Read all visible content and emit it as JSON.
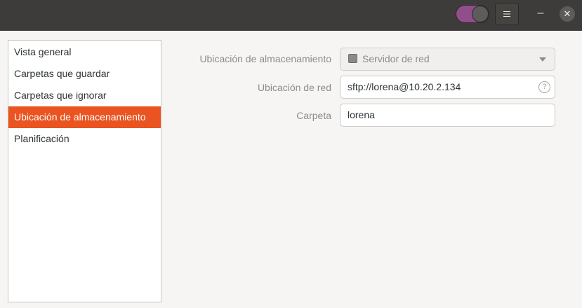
{
  "header": {
    "toggle_state": "on",
    "menu_icon": "hamburger-icon",
    "minimize_glyph": "–",
    "close_glyph": "✕"
  },
  "sidebar": {
    "items": [
      {
        "label": "Vista general",
        "active": false
      },
      {
        "label": "Carpetas que guardar",
        "active": false
      },
      {
        "label": "Carpetas que ignorar",
        "active": false
      },
      {
        "label": "Ubicación de almacenamiento",
        "active": true
      },
      {
        "label": "Planificación",
        "active": false
      }
    ]
  },
  "form": {
    "storage_location": {
      "label": "Ubicación de almacenamiento",
      "selected": "Servidor de red"
    },
    "network_location": {
      "label": "Ubicación de red",
      "value": "sftp://lorena@10.20.2.134"
    },
    "folder": {
      "label": "Carpeta",
      "value": "lorena"
    }
  },
  "colors": {
    "accent": "#e95420",
    "toggle": "#924d8b",
    "titlebar": "#3d3c3a"
  }
}
